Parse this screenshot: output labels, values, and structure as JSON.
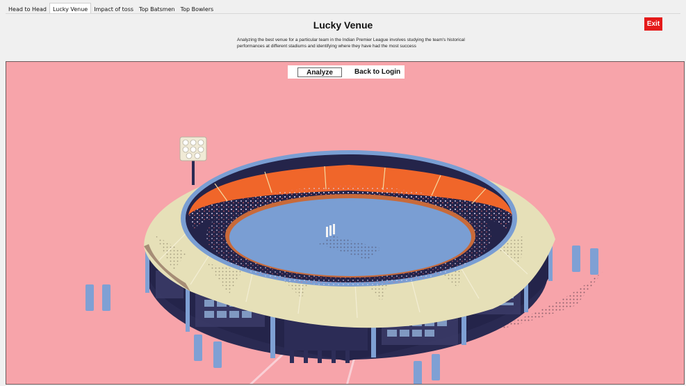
{
  "tabs": [
    {
      "label": "Head to Head"
    },
    {
      "label": "Lucky Venue"
    },
    {
      "label": "Impact of toss"
    },
    {
      "label": "Top Batsmen"
    },
    {
      "label": "Top Bowlers"
    }
  ],
  "active_tab_index": 1,
  "header": {
    "title": "Lucky Venue",
    "description": "Analyzing the best venue for a particular team in the Indian Premier League involves studying the team's historical performances at different stadiums and identifying where they have had the most success",
    "exit_label": "Exit"
  },
  "toolbar": {
    "analyze_label": "Analyze",
    "back_label": "Back to Login"
  },
  "colors": {
    "background_pink": "#f7a4aa",
    "exit_red": "#e51a1a",
    "stand_orange": "#f0662a",
    "field_blue": "#7a9ed3",
    "roof_cream": "#e6e0b8",
    "dark_navy": "#24244a"
  },
  "illustration": {
    "name": "cricket-stadium-illustration"
  }
}
